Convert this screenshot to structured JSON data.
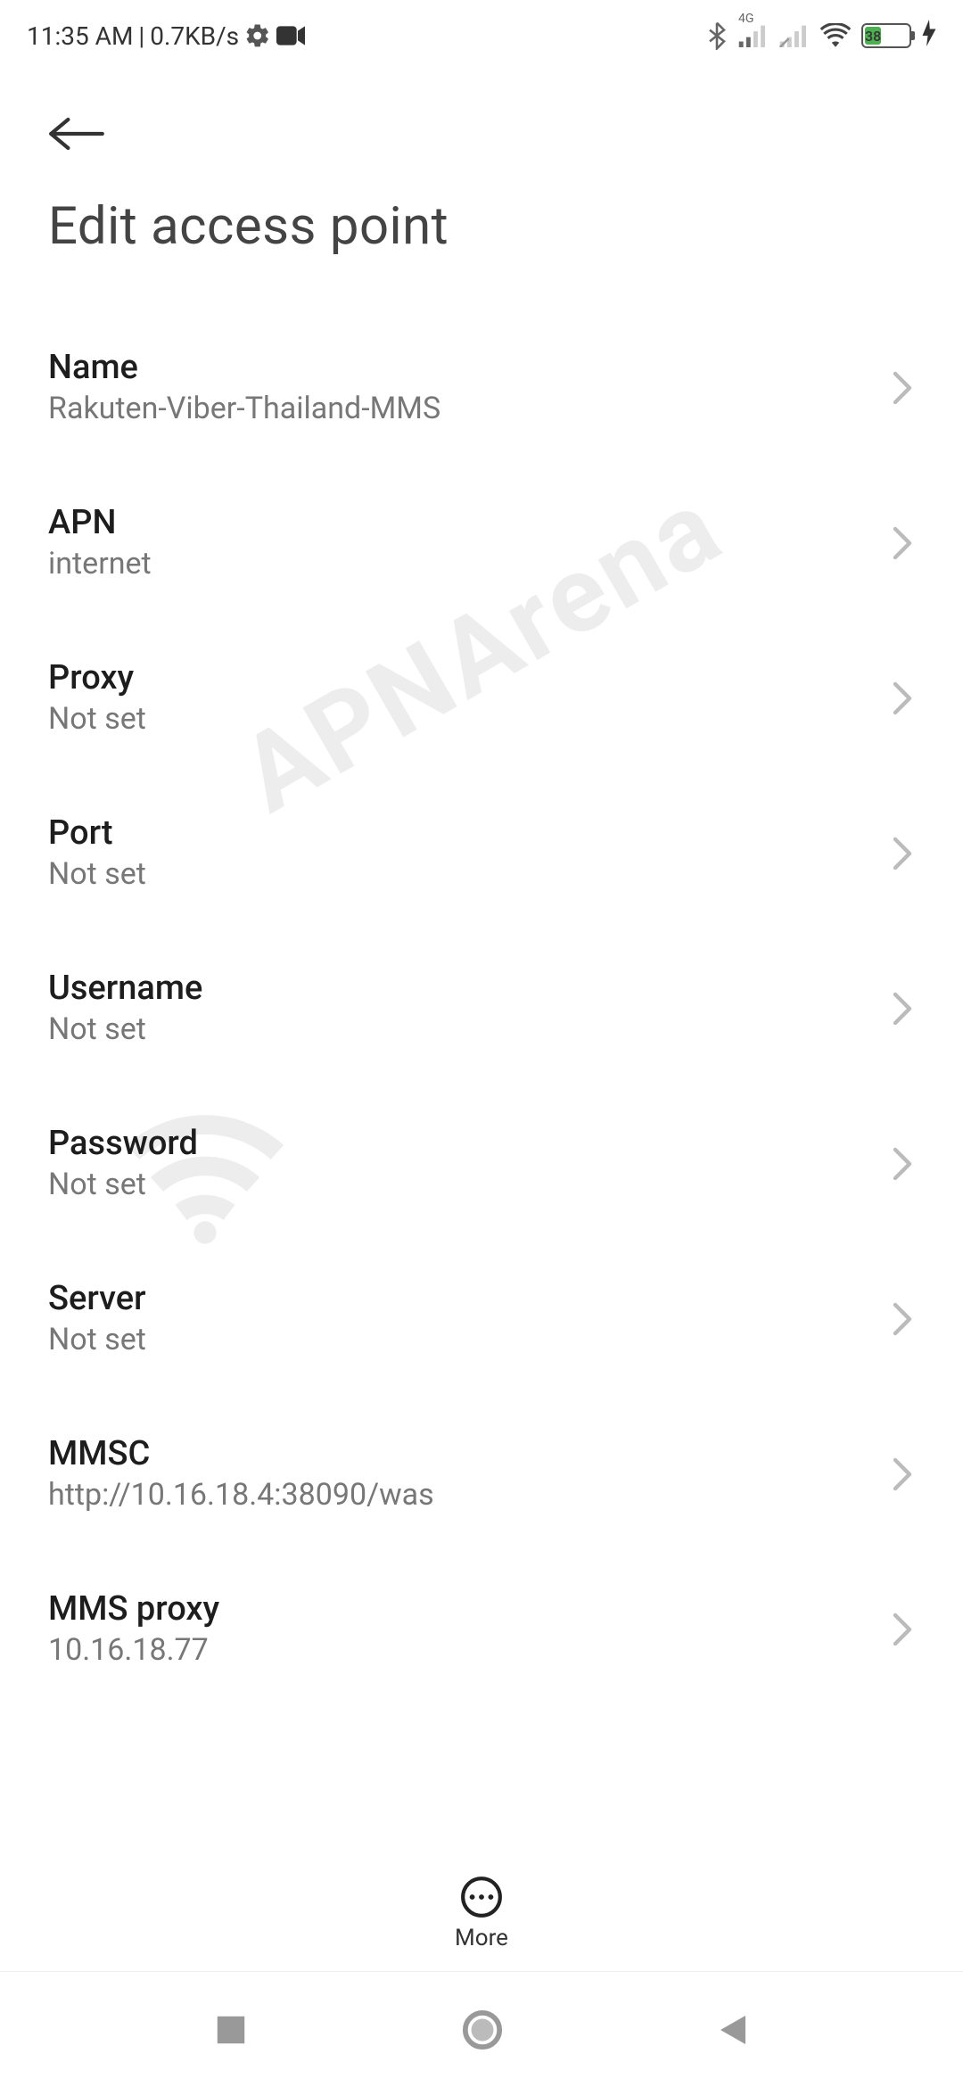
{
  "status": {
    "time": "11:35 AM",
    "separator": " | ",
    "speed": "0.7KB/s",
    "network_label": "4G",
    "battery_text": "38"
  },
  "header": {
    "title": "Edit access point"
  },
  "rows": {
    "name": {
      "label": "Name",
      "value": "Rakuten-Viber-Thailand-MMS"
    },
    "apn": {
      "label": "APN",
      "value": "internet"
    },
    "proxy": {
      "label": "Proxy",
      "value": "Not set"
    },
    "port": {
      "label": "Port",
      "value": "Not set"
    },
    "username": {
      "label": "Username",
      "value": "Not set"
    },
    "password": {
      "label": "Password",
      "value": "Not set"
    },
    "server": {
      "label": "Server",
      "value": "Not set"
    },
    "mmsc": {
      "label": "MMSC",
      "value": "http://10.16.18.4:38090/was"
    },
    "mms_proxy": {
      "label": "MMS proxy",
      "value": "10.16.18.77"
    }
  },
  "toolbar": {
    "more_label": "More"
  },
  "watermark": {
    "text": "APNArena"
  }
}
